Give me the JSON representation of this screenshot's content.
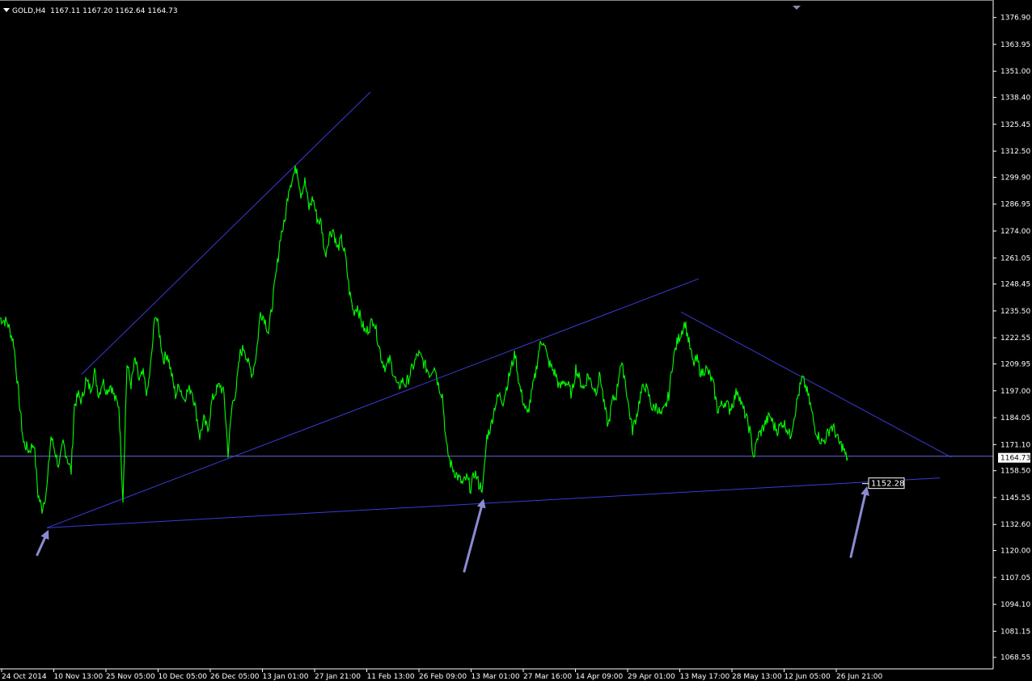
{
  "header": {
    "symbol": "GOLD,H4",
    "ohlc": "1167.11 1167.20 1162.64 1164.73"
  },
  "colors": {
    "background": "#000000",
    "price": "#00ff00",
    "trendline": "#3b3bd6",
    "hline": "#6a6ad8",
    "arrow": "#8b8bd1",
    "axis": "#ffffff"
  },
  "chart_data": {
    "type": "line",
    "ylim": [
      1063.0,
      1383.0
    ],
    "y_ticks": [
      "1376.90",
      "1363.95",
      "1351.00",
      "1338.40",
      "1325.45",
      "1312.50",
      "1299.90",
      "1286.95",
      "1274.00",
      "1261.05",
      "1248.45",
      "1235.50",
      "1222.55",
      "1209.95",
      "1197.00",
      "1184.05",
      "1171.10",
      "1158.50",
      "1145.55",
      "1132.60",
      "1120.00",
      "1107.05",
      "1094.10",
      "1081.15",
      "1068.55"
    ],
    "x_ticks": [
      "24 Oct 2014",
      "10 Nov 13:00",
      "25 Nov 05:00",
      "10 Dec 05:00",
      "26 Dec 05:00",
      "13 Jan 01:00",
      "27 Jan 21:00",
      "11 Feb 13:00",
      "26 Feb 09:00",
      "13 Mar 01:00",
      "27 Mar 16:00",
      "14 Apr 09:00",
      "29 Apr 01:00",
      "13 May 17:00",
      "28 May 13:00",
      "12 Jun 05:00",
      "26 Jun 21:00"
    ],
    "last_price": "1164.73",
    "support_label": "1152.28",
    "series": [
      {
        "points": [
          [
            0,
            1232
          ],
          [
            9,
            1230
          ],
          [
            17,
            1220
          ],
          [
            23,
            1195
          ],
          [
            29,
            1172
          ],
          [
            36,
            1168
          ],
          [
            42,
            1172
          ],
          [
            47,
            1147
          ],
          [
            52,
            1140
          ],
          [
            58,
            1150
          ],
          [
            63,
            1175
          ],
          [
            68,
            1168
          ],
          [
            73,
            1160
          ],
          [
            78,
            1172
          ],
          [
            83,
            1165
          ],
          [
            88,
            1158
          ],
          [
            92,
            1190
          ],
          [
            97,
            1195
          ],
          [
            101,
            1192
          ],
          [
            106,
            1202
          ],
          [
            112,
            1198
          ],
          [
            117,
            1206
          ],
          [
            122,
            1195
          ],
          [
            127,
            1202
          ],
          [
            132,
            1197
          ],
          [
            137,
            1200
          ],
          [
            142,
            1193
          ],
          [
            147,
            1190
          ],
          [
            152,
            1145
          ],
          [
            157,
            1210
          ],
          [
            162,
            1200
          ],
          [
            167,
            1212
          ],
          [
            172,
            1202
          ],
          [
            177,
            1205
          ],
          [
            182,
            1195
          ],
          [
            187,
            1212
          ],
          [
            192,
            1235
          ],
          [
            197,
            1225
          ],
          [
            202,
            1212
          ],
          [
            207,
            1215
          ],
          [
            212,
            1205
          ],
          [
            217,
            1195
          ],
          [
            222,
            1200
          ],
          [
            227,
            1193
          ],
          [
            232,
            1197
          ],
          [
            237,
            1198
          ],
          [
            242,
            1188
          ],
          [
            247,
            1175
          ],
          [
            252,
            1183
          ],
          [
            257,
            1178
          ],
          [
            262,
            1192
          ],
          [
            267,
            1197
          ],
          [
            272,
            1200
          ],
          [
            277,
            1195
          ],
          [
            282,
            1167
          ],
          [
            287,
            1190
          ],
          [
            292,
            1198
          ],
          [
            297,
            1215
          ],
          [
            302,
            1218
          ],
          [
            307,
            1210
          ],
          [
            312,
            1205
          ],
          [
            317,
            1215
          ],
          [
            322,
            1235
          ],
          [
            327,
            1232
          ],
          [
            332,
            1225
          ],
          [
            337,
            1240
          ],
          [
            342,
            1255
          ],
          [
            347,
            1272
          ],
          [
            352,
            1278
          ],
          [
            357,
            1295
          ],
          [
            362,
            1300
          ],
          [
            367,
            1305
          ],
          [
            372,
            1292
          ],
          [
            377,
            1298
          ],
          [
            382,
            1285
          ],
          [
            387,
            1290
          ],
          [
            392,
            1280
          ],
          [
            397,
            1278
          ],
          [
            402,
            1262
          ],
          [
            407,
            1272
          ],
          [
            412,
            1275
          ],
          [
            417,
            1265
          ],
          [
            422,
            1270
          ],
          [
            427,
            1262
          ],
          [
            432,
            1245
          ],
          [
            437,
            1235
          ],
          [
            442,
            1238
          ],
          [
            447,
            1230
          ],
          [
            452,
            1225
          ],
          [
            457,
            1228
          ],
          [
            462,
            1232
          ],
          [
            467,
            1222
          ],
          [
            472,
            1212
          ],
          [
            477,
            1208
          ],
          [
            482,
            1212
          ],
          [
            487,
            1205
          ],
          [
            492,
            1198
          ],
          [
            497,
            1202
          ],
          [
            502,
            1200
          ],
          [
            507,
            1205
          ],
          [
            512,
            1210
          ],
          [
            517,
            1215
          ],
          [
            522,
            1212
          ],
          [
            527,
            1208
          ],
          [
            532,
            1205
          ],
          [
            537,
            1210
          ],
          [
            542,
            1200
          ],
          [
            547,
            1195
          ],
          [
            552,
            1170
          ],
          [
            557,
            1162
          ],
          [
            562,
            1158
          ],
          [
            567,
            1155
          ],
          [
            572,
            1152
          ],
          [
            577,
            1155
          ],
          [
            582,
            1150
          ],
          [
            587,
            1158
          ],
          [
            592,
            1152
          ],
          [
            597,
            1150
          ],
          [
            602,
            1175
          ],
          [
            607,
            1180
          ],
          [
            612,
            1190
          ],
          [
            617,
            1195
          ],
          [
            622,
            1192
          ],
          [
            627,
            1200
          ],
          [
            632,
            1208
          ],
          [
            637,
            1215
          ],
          [
            642,
            1200
          ],
          [
            647,
            1192
          ],
          [
            652,
            1185
          ],
          [
            657,
            1195
          ],
          [
            662,
            1205
          ],
          [
            667,
            1218
          ],
          [
            672,
            1222
          ],
          [
            677,
            1212
          ],
          [
            682,
            1208
          ],
          [
            687,
            1205
          ],
          [
            692,
            1198
          ],
          [
            697,
            1202
          ],
          [
            702,
            1200
          ],
          [
            707,
            1195
          ],
          [
            712,
            1208
          ],
          [
            717,
            1202
          ],
          [
            722,
            1198
          ],
          [
            727,
            1205
          ],
          [
            732,
            1200
          ],
          [
            737,
            1197
          ],
          [
            742,
            1205
          ],
          [
            747,
            1190
          ],
          [
            752,
            1180
          ],
          [
            757,
            1192
          ],
          [
            762,
            1195
          ],
          [
            767,
            1210
          ],
          [
            772,
            1205
          ],
          [
            777,
            1190
          ],
          [
            782,
            1178
          ],
          [
            787,
            1185
          ],
          [
            792,
            1195
          ],
          [
            797,
            1200
          ],
          [
            802,
            1195
          ],
          [
            807,
            1188
          ],
          [
            812,
            1190
          ],
          [
            817,
            1185
          ],
          [
            822,
            1188
          ],
          [
            827,
            1195
          ],
          [
            832,
            1212
          ],
          [
            837,
            1220
          ],
          [
            842,
            1225
          ],
          [
            847,
            1230
          ],
          [
            852,
            1220
          ],
          [
            857,
            1210
          ],
          [
            862,
            1212
          ],
          [
            867,
            1205
          ],
          [
            872,
            1208
          ],
          [
            877,
            1205
          ],
          [
            882,
            1200
          ],
          [
            887,
            1188
          ],
          [
            892,
            1190
          ],
          [
            897,
            1192
          ],
          [
            902,
            1188
          ],
          [
            907,
            1192
          ],
          [
            912,
            1198
          ],
          [
            917,
            1190
          ],
          [
            922,
            1185
          ],
          [
            927,
            1178
          ],
          [
            932,
            1165
          ],
          [
            937,
            1175
          ],
          [
            942,
            1178
          ],
          [
            947,
            1182
          ],
          [
            952,
            1185
          ],
          [
            957,
            1180
          ],
          [
            962,
            1178
          ],
          [
            967,
            1182
          ],
          [
            972,
            1180
          ],
          [
            977,
            1175
          ],
          [
            982,
            1185
          ],
          [
            987,
            1195
          ],
          [
            992,
            1203
          ],
          [
            997,
            1198
          ],
          [
            1002,
            1190
          ],
          [
            1007,
            1180
          ],
          [
            1012,
            1175
          ],
          [
            1017,
            1172
          ],
          [
            1022,
            1175
          ],
          [
            1027,
            1180
          ],
          [
            1032,
            1178
          ],
          [
            1037,
            1172
          ],
          [
            1042,
            1170
          ],
          [
            1046,
            1165
          ],
          [
            1048,
            1164.73
          ]
        ]
      }
    ],
    "trendlines": [
      {
        "points": [
          [
            101,
            1205
          ],
          [
            458,
            1341
          ]
        ]
      },
      {
        "points": [
          [
            58,
            1131
          ],
          [
            864,
            1251
          ]
        ]
      },
      {
        "points": [
          [
            58,
            1131
          ],
          [
            1162,
            1155
          ]
        ]
      },
      {
        "points": [
          [
            842,
            1235
          ],
          [
            1176,
            1165
          ]
        ]
      }
    ],
    "hlines": [
      1165.5
    ],
    "arrows": [
      {
        "from": [
          46,
          1118
        ],
        "to": [
          60,
          1130
        ]
      },
      {
        "from": [
          574,
          1110
        ],
        "to": [
          598,
          1145
        ]
      },
      {
        "from": [
          1052,
          1117
        ],
        "to": [
          1072,
          1151
        ]
      }
    ],
    "support_label_at": [
      1096,
      1152.28
    ]
  }
}
